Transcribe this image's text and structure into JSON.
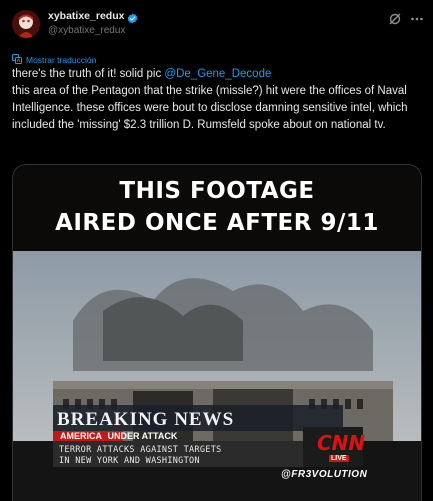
{
  "user": {
    "display_name": "xybatixe_redux",
    "handle": "@xybatixe_redux"
  },
  "icons": {
    "verified": "verified-badge-icon",
    "grok": "grok-icon",
    "more": "more-icon",
    "translate": "translate-icon"
  },
  "colors": {
    "accent": "#1d9bf0",
    "background": "#000000",
    "text": "#e7e9ea",
    "secondary": "#71767b"
  },
  "tweet": {
    "translate_label": "Mostrar traducción",
    "line1_text": "there's the truth of it! solid pic ",
    "mention": "@De_Gene_Decode",
    "line2_text": "this area of the Pentagon that the strike (missle?) hit were the offices of Naval Intelligence. these offices were bout to disclose damning sensitive intel, which included the 'missing'  $2.3 trillion D. Rumsfeld spoke about on national tv."
  },
  "media": {
    "caption_line1": "THIS FOOTAGE",
    "caption_line2": "AIRED ONCE AFTER 9/11",
    "breaking_news": "BREAKING NEWS",
    "america": "AMERICA",
    "under_attack": "UNDER ATTACK",
    "ticker_line1": "TERROR ATTACKS AGAINST TARGETS",
    "ticker_line2": "IN NEW YORK AND WASHINGTON",
    "network": "CNN",
    "live": "LIVE",
    "watermark": "@FR3VOLUTION"
  }
}
